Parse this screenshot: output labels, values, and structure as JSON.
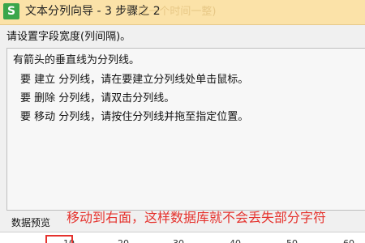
{
  "window": {
    "app_icon_glyph": "S",
    "title": "文本分列向导 - 3 步骤之 2",
    "title_watermark": "(2一个时间一整)"
  },
  "step": {
    "prompt": "请设置字段宽度(列间隔)。"
  },
  "instructions": {
    "lines": [
      "有箭头的垂直线为分列线。",
      "要 建立 分列线，请在要建立分列线处单击鼠标。",
      "要 删除 分列线，请双击分列线。",
      "要 移动 分列线，请按住分列线并拖至指定位置。"
    ]
  },
  "preview": {
    "label": "数据预览",
    "ruler_ticks": [
      "10",
      "20",
      "30",
      "40",
      "50",
      "60"
    ]
  },
  "annotation": {
    "text": "移动到右面，这样数据库就不会丢失部分字符",
    "color": "#e5322d"
  },
  "colors": {
    "titlebar": "#fbe2a8",
    "app_icon": "#3aa64a",
    "window_bg": "#f0f0f0",
    "info_bg": "#f7f7f7"
  }
}
